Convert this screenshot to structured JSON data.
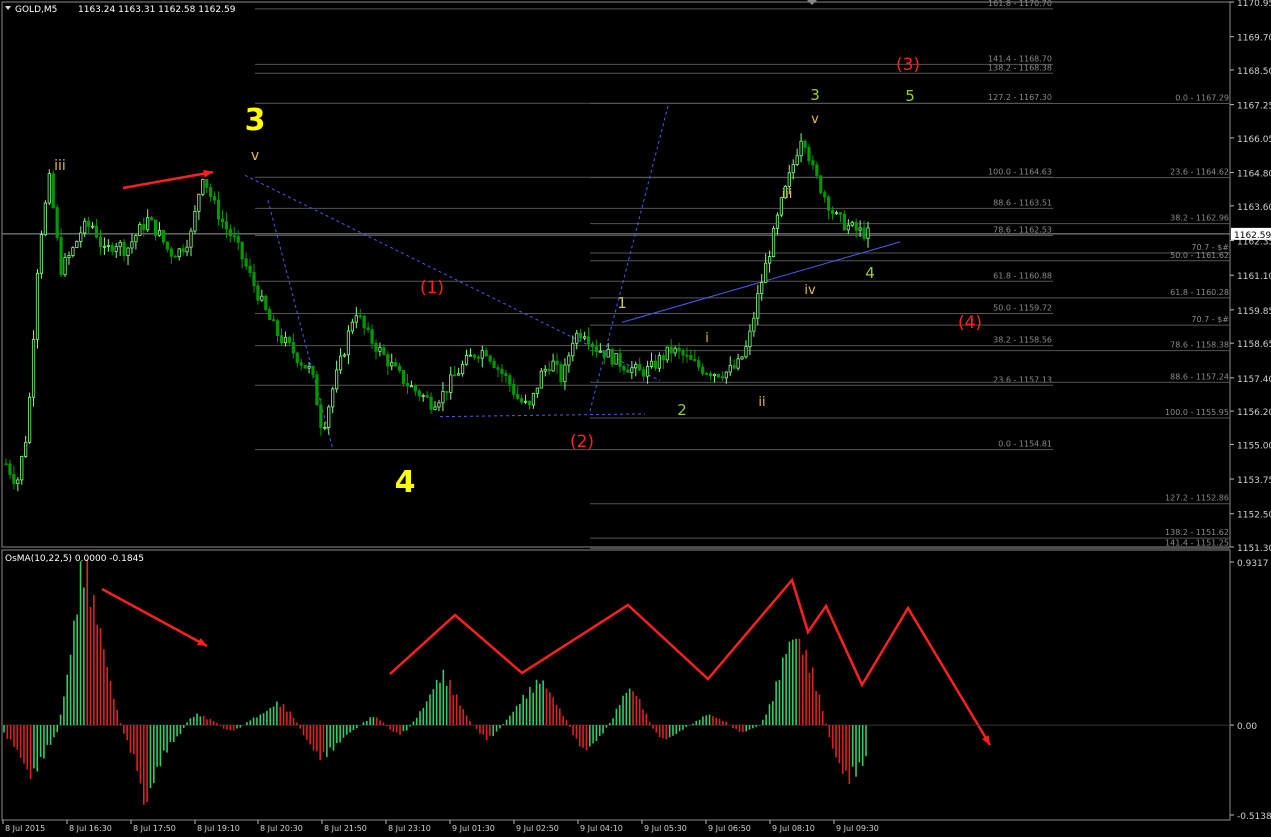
{
  "chart_data": {
    "type": "candlestick",
    "symbol_header": "GOLD,M5",
    "header_ohlc": "1163.24 1163.31 1162.58 1162.59",
    "indicator_header": "OsMA(10,22,5) 0.0000 -0.1845",
    "price_axis": {
      "ylim": [
        1151.3,
        1170.95
      ],
      "ticks": [
        "1170.95",
        "1169.70",
        "1168.50",
        "1167.25",
        "1166.05",
        "1164.80",
        "1163.60",
        "1162.35",
        "1161.10",
        "1159.85",
        "1158.65",
        "1157.40",
        "1156.20",
        "1155.00",
        "1153.75",
        "1152.50",
        "1151.30"
      ],
      "current_price": "1162.59"
    },
    "osma_axis": {
      "ylim": [
        -0.5138,
        0.9317
      ],
      "ticks": [
        "0.9317",
        "0.00",
        "-0.5138"
      ]
    },
    "time_labels": [
      "8 Jul 2015",
      "8 Jul 16:30",
      "8 Jul 17:50",
      "8 Jul 19:10",
      "8 Jul 20:30",
      "8 Jul 21:50",
      "8 Jul 23:10",
      "9 Jul 01:30",
      "9 Jul 02:50",
      "9 Jul 04:10",
      "9 Jul 05:30",
      "9 Jul 06:50",
      "9 Jul 08:10",
      "9 Jul 09:30"
    ],
    "price_path": [
      1154.3,
      1153.6,
      1155.6,
      1162.1,
      1164.6,
      1161.3,
      1161.9,
      1162.8,
      1162.9,
      1161.9,
      1162.3,
      1162.0,
      1162.6,
      1163.1,
      1162.6,
      1161.9,
      1162.0,
      1162.6,
      1164.8,
      1163.7,
      1162.9,
      1162.3,
      1161.4,
      1160.5,
      1159.6,
      1158.9,
      1158.5,
      1158.0,
      1157.6,
      1155.5,
      1157.1,
      1158.4,
      1159.9,
      1159.0,
      1158.5,
      1158.0,
      1157.5,
      1157.1,
      1156.8,
      1156.5,
      1156.8,
      1157.4,
      1157.9,
      1158.3,
      1158.4,
      1157.8,
      1157.3,
      1156.6,
      1156.3,
      1157.5,
      1158.0,
      1157.3,
      1158.9,
      1159.1,
      1158.5,
      1158.3,
      1158.0,
      1157.8,
      1157.6,
      1157.7,
      1158.1,
      1158.4,
      1158.2,
      1157.9,
      1157.7,
      1157.6,
      1157.6,
      1157.8,
      1158.6,
      1160.5,
      1162.0,
      1163.6,
      1164.9,
      1166.3,
      1164.8,
      1164.0,
      1163.2,
      1162.9,
      1162.7,
      1162.59
    ],
    "osma_histogram": [
      -0.05,
      -0.1,
      -0.18,
      -0.28,
      -0.22,
      -0.12,
      -0.05,
      0.2,
      0.55,
      0.93,
      0.7,
      0.5,
      0.25,
      0.05,
      -0.1,
      -0.2,
      -0.45,
      -0.3,
      -0.18,
      -0.1,
      -0.05,
      0.03,
      0.06,
      0.04,
      0.02,
      -0.02,
      -0.03,
      -0.01,
      0.03,
      0.05,
      0.08,
      0.12,
      0.1,
      0.04,
      -0.05,
      -0.12,
      -0.18,
      -0.15,
      -0.1,
      -0.05,
      -0.02,
      0.02,
      0.05,
      0.02,
      -0.03,
      -0.05,
      -0.02,
      0.05,
      0.12,
      0.22,
      0.28,
      0.2,
      0.1,
      0.02,
      -0.04,
      -0.08,
      -0.04,
      0.02,
      0.08,
      0.15,
      0.2,
      0.25,
      0.18,
      0.1,
      0.02,
      -0.08,
      -0.14,
      -0.1,
      -0.05,
      0.02,
      0.12,
      0.2,
      0.16,
      0.06,
      -0.04,
      -0.08,
      -0.06,
      -0.03,
      0.0,
      0.03,
      0.06,
      0.04,
      0.02,
      -0.02,
      -0.04,
      -0.02,
      0.0,
      0.1,
      0.25,
      0.42,
      0.48,
      0.4,
      0.28,
      0.1,
      -0.1,
      -0.22,
      -0.3,
      -0.25,
      -0.18
    ],
    "fibo_left": [
      {
        "label": "161.8 - 1170.70",
        "price": 1170.7
      },
      {
        "label": "141.4 - 1168.70",
        "price": 1168.7
      },
      {
        "label": "138.2 - 1168.38",
        "price": 1168.38
      },
      {
        "label": "127.2 - 1167.30",
        "price": 1167.3
      },
      {
        "label": "100.0 - 1164.63",
        "price": 1164.63
      },
      {
        "label": "88.6 - 1163.51",
        "price": 1163.51
      },
      {
        "label": "78.6 - 1162.53",
        "price": 1162.53
      },
      {
        "label": "61.8 - 1160.88",
        "price": 1160.88
      },
      {
        "label": "50.0 - 1159.72",
        "price": 1159.72
      },
      {
        "label": "38.2 - 1158.56",
        "price": 1158.56
      },
      {
        "label": "23.6 - 1157.13",
        "price": 1157.13
      },
      {
        "label": "0.0 - 1154.81",
        "price": 1154.81
      }
    ],
    "fibo_right": [
      {
        "label": "0.0 - 1167.29",
        "price": 1167.29
      },
      {
        "label": "23.6 - 1164.62",
        "price": 1164.62
      },
      {
        "label": "38.2 - 1162.96",
        "price": 1162.96
      },
      {
        "label": "70.7 - $#",
        "price": 1161.9
      },
      {
        "label": "50.0 - 1161.62",
        "price": 1161.62
      },
      {
        "label": "61.8 - 1160.28",
        "price": 1160.28
      },
      {
        "label": "70.7 - $#",
        "price": 1159.3
      },
      {
        "label": "78.6 - 1158.38",
        "price": 1158.38
      },
      {
        "label": "88.6 - 1157.24",
        "price": 1157.24
      },
      {
        "label": "100.0 - 1155.95",
        "price": 1155.95
      },
      {
        "label": "127.2 - 1152.86",
        "price": 1152.86
      },
      {
        "label": "138.2 - 1151.62",
        "price": 1151.62
      },
      {
        "label": "141.4 - 1151.25",
        "price": 1151.25
      }
    ],
    "wave_labels": [
      {
        "text": "3",
        "color": "#ffff00",
        "size": "xl"
      },
      {
        "text": "4",
        "color": "#ffff00",
        "size": "xl"
      },
      {
        "text": "iii",
        "color": "#e8b84a",
        "size": "s"
      },
      {
        "text": "v",
        "color": "#e8b84a",
        "size": "s"
      },
      {
        "text": "(1)",
        "color": "#ff2020",
        "size": "m"
      },
      {
        "text": "(2)",
        "color": "#ff2020",
        "size": "m"
      },
      {
        "text": "(3)",
        "color": "#ff2020",
        "size": "m"
      },
      {
        "text": "(4)",
        "color": "#ff2020",
        "size": "m"
      },
      {
        "text": "1",
        "color": "#c8c850",
        "size": "m"
      },
      {
        "text": "2",
        "color": "#9acd32",
        "size": "m"
      },
      {
        "text": "3",
        "color": "#9acd32",
        "size": "m"
      },
      {
        "text": "4",
        "color": "#9acd32",
        "size": "m"
      },
      {
        "text": "5",
        "color": "#9acd32",
        "size": "m"
      },
      {
        "text": "i",
        "color": "#e8b84a",
        "size": "s"
      },
      {
        "text": "ii",
        "color": "#e8b84a",
        "size": "s"
      },
      {
        "text": "iii",
        "color": "#e8b84a",
        "size": "s"
      },
      {
        "text": "iv",
        "color": "#e8b84a",
        "size": "s"
      },
      {
        "text": "v",
        "color": "#e8b84a",
        "size": "s"
      }
    ],
    "colors": {
      "background": "#000000",
      "bull_candle": "#7fff7f",
      "bear_candle": "#009900",
      "grid_line": "#555555",
      "fibo_text": "#8a8a8a",
      "trendline": "#4a5ae8",
      "annotation_arrow": "#ff2020",
      "osma_up": "#33cc66",
      "osma_down": "#dd2222",
      "axis_text": "#cfcfcf"
    }
  }
}
